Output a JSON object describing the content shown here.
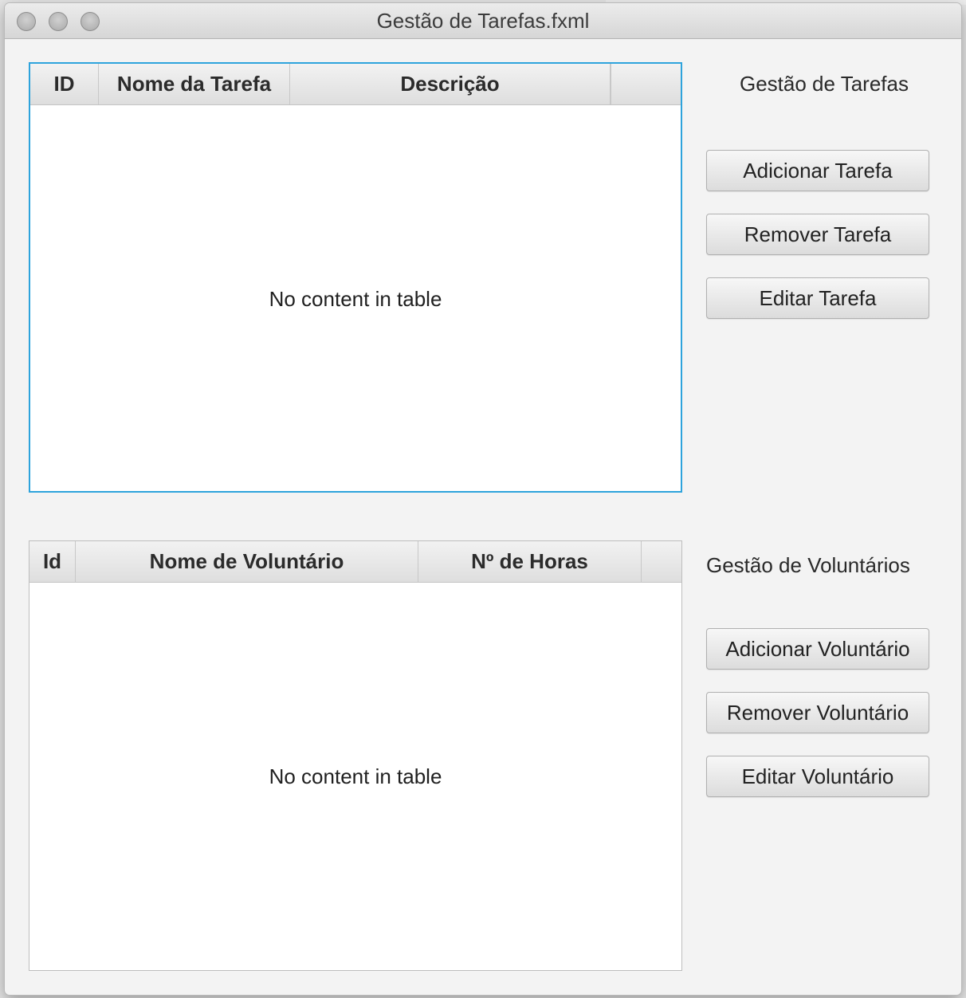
{
  "window": {
    "title": "Gestão de Tarefas.fxml"
  },
  "tasks": {
    "section_label": "Gestão de Tarefas",
    "columns": [
      "ID",
      "Nome da Tarefa",
      "Descrição"
    ],
    "empty_message": "No content in table",
    "buttons": {
      "add": "Adicionar Tarefa",
      "remove": "Remover Tarefa",
      "edit": "Editar Tarefa"
    }
  },
  "volunteers": {
    "section_label": "Gestão de Voluntários",
    "columns": [
      "Id",
      "Nome de Voluntário",
      "Nº de Horas"
    ],
    "empty_message": "No content in table",
    "buttons": {
      "add": "Adicionar Voluntário",
      "remove": "Remover Voluntário",
      "edit": "Editar Voluntário"
    }
  },
  "colors": {
    "focus_border": "#2ea3dc",
    "window_background": "#f3f3f3"
  }
}
